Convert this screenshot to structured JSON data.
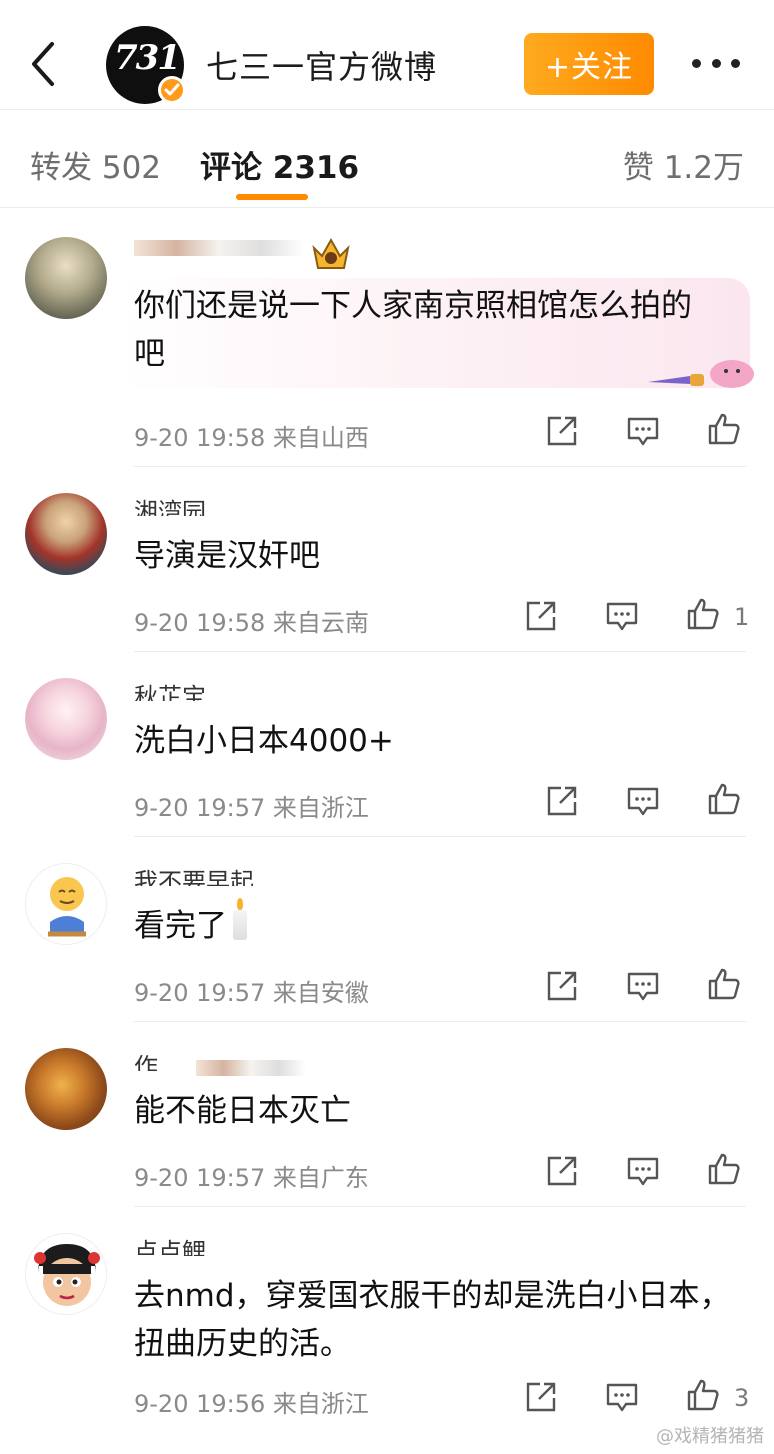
{
  "header": {
    "back_icon": "chevron-left-icon",
    "logo_text": "731",
    "account_name": "七三一官方微博",
    "follow_label": "+关注",
    "more_icon": "more-horizontal-icon"
  },
  "tabs": {
    "repost": "转发 502",
    "comments": "评论 2316",
    "likes": "赞 1.2万"
  },
  "comments": [
    {
      "text_lines": [
        "你们还是说一下人家南京照相馆怎么拍的",
        "吧"
      ],
      "time": "9-20 19:58",
      "location": "来自山西",
      "likes": ""
    },
    {
      "name": "湘湾园",
      "text_lines": [
        "导演是汉奸吧"
      ],
      "time": "9-20 19:58",
      "location": "来自云南",
      "likes": "1"
    },
    {
      "name": "秋芷宝",
      "text_lines": [
        "洗白小日本4000+"
      ],
      "time": "9-20 19:57",
      "location": "来自浙江",
      "likes": ""
    },
    {
      "name": "我不要早起",
      "text_lines": [
        "看完了"
      ],
      "time": "9-20 19:57",
      "location": "来自安徽",
      "likes": ""
    },
    {
      "name": "作",
      "text_lines": [
        "能不能日本灭亡"
      ],
      "time": "9-20 19:57",
      "location": "来自广东",
      "likes": ""
    },
    {
      "name": "点点鲤",
      "text_lines": [
        "去nmd，穿爱国衣服干的却是洗白小日本，",
        "扭曲历史的活。"
      ],
      "time": "9-20 19:56",
      "location": "来自浙江",
      "likes": "3"
    }
  ],
  "watermark": "@戏精猪猪猪",
  "colors": {
    "accent": "#ff8a00",
    "follow_gradient_start": "#ffaa1f",
    "verified": "#ff9a1b",
    "meta_text": "#8a8a8a"
  }
}
